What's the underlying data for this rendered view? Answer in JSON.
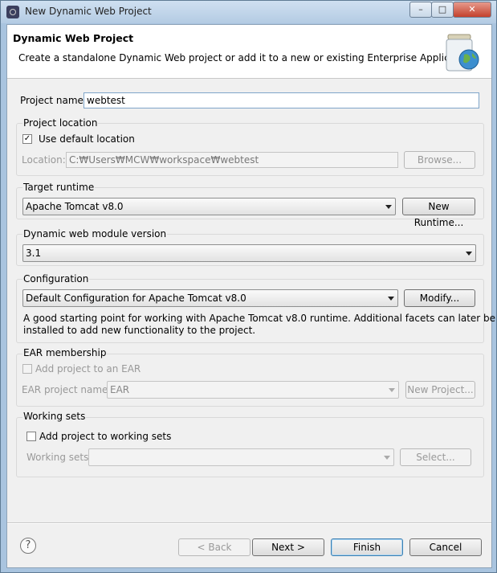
{
  "window": {
    "title": "New Dynamic Web Project",
    "minimize": "–",
    "maximize": "□",
    "close": "✕"
  },
  "banner": {
    "title": "Dynamic Web Project",
    "description": "Create a standalone Dynamic Web project or add it to a new or existing Enterprise Application.",
    "icon": "jar-globe-icon"
  },
  "project_name": {
    "label": "Project name:",
    "value": "webtest"
  },
  "project_location": {
    "group_title": "Project location",
    "use_default_label": "Use default location",
    "use_default_checked": "✓",
    "location_label": "Location:",
    "location_value": "C:₩Users₩MCW₩workspace₩webtest",
    "browse_label": "Browse..."
  },
  "target_runtime": {
    "group_title": "Target runtime",
    "selected": "Apache Tomcat v8.0",
    "new_runtime_label": "New Runtime..."
  },
  "module_version": {
    "group_title": "Dynamic web module version",
    "selected": "3.1"
  },
  "configuration": {
    "group_title": "Configuration",
    "selected": "Default Configuration for Apache Tomcat v8.0",
    "modify_label": "Modify...",
    "description_line1": "A good starting point for working with Apache Tomcat v8.0 runtime. Additional facets can later be",
    "description_line2": "installed to add new functionality to the project."
  },
  "ear_membership": {
    "group_title": "EAR membership",
    "add_label": "Add project to an EAR",
    "ear_name_label": "EAR project name:",
    "ear_name_value": "EAR",
    "new_project_label": "New Project..."
  },
  "working_sets": {
    "group_title": "Working sets",
    "add_label": "Add project to working sets",
    "sets_label": "Working sets:",
    "select_label": "Select..."
  },
  "footer": {
    "help": "?",
    "back_label": "< Back",
    "next_label": "Next >",
    "finish_label": "Finish",
    "cancel_label": "Cancel"
  }
}
